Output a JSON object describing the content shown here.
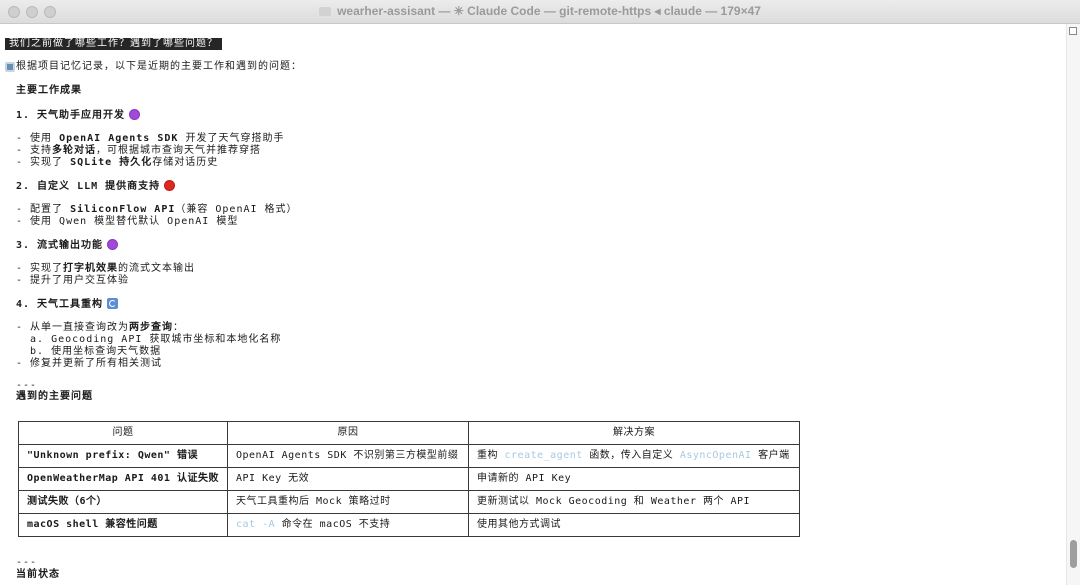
{
  "window": {
    "title": "wearher-assisant — ✳ Claude Code — git-remote-https ◂ claude — 179×47"
  },
  "prompt": {
    "text": " 我们之前做了哪些工作？遇到了哪些问题？"
  },
  "answer": {
    "intro": "根据项目记忆记录，以下是近期的主要工作和遇到的问题：",
    "section_achievements": "主要工作成果",
    "items": [
      {
        "heading": "1. 天气助手应用开发",
        "bullets": [
          [
            "- 使用 ",
            "OpenAI Agents SDK",
            " 开发了天气穿搭助手"
          ],
          [
            "- 支持",
            "多轮对话",
            "，可根据城市查询天气并推荐穿搭"
          ],
          [
            "- 实现了 ",
            "SQLite 持久化",
            "存储对话历史"
          ]
        ]
      },
      {
        "heading": "2. 自定义 LLM 提供商支持",
        "bullets": [
          [
            "- 配置了 ",
            "SiliconFlow API",
            "（兼容 OpenAI 格式）"
          ],
          [
            "- 使用 Qwen 模型替代默认 OpenAI 模型",
            "",
            ""
          ]
        ]
      },
      {
        "heading": "3. 流式输出功能",
        "bullets": [
          [
            "- 实现了",
            "打字机效果",
            "的流式文本输出"
          ],
          [
            "- 提升了用户交互体验",
            "",
            ""
          ]
        ]
      },
      {
        "heading": "4. 天气工具重构",
        "bullets": [
          [
            "- 从单一直接查询改为",
            "两步查询",
            "："
          ],
          [
            "  a. Geocoding API 获取城市坐标和本地化名称",
            "",
            ""
          ],
          [
            "  b. 使用坐标查询天气数据",
            "",
            ""
          ],
          [
            "- 修复并更新了所有相关测试",
            "",
            ""
          ]
        ]
      }
    ],
    "separator": "---",
    "section_problems": "遇到的主要问题",
    "table": {
      "headers": [
        "问题",
        "原因",
        "解决方案"
      ],
      "rows": [
        {
          "problem": "\"Unknown prefix: Qwen\" 错误",
          "cause": "OpenAI Agents SDK 不识别第三方模型前缀",
          "solution_pre": "重构 ",
          "solution_code1": "create_agent",
          "solution_mid": " 函数，传入自定义 ",
          "solution_code2": "AsyncOpenAI",
          "solution_post": " 客户端"
        },
        {
          "problem": "OpenWeatherMap API 401 认证失败",
          "cause": "API Key 无效",
          "solution": "申请新的 API Key"
        },
        {
          "problem": "测试失败（6个）",
          "cause": "天气工具重构后 Mock 策略过时",
          "solution": "更新测试以 Mock Geocoding 和 Weather 两个 API"
        },
        {
          "problem": "macOS shell 兼容性问题",
          "cause_code": "cat -A",
          "cause_post": " 命令在 macOS 不支持",
          "solution": "使用其他方式调试"
        }
      ]
    },
    "separator2": "---",
    "section_status": "当前状态"
  },
  "colors": {
    "prompt_bg": "#262626",
    "code_highlight": "#a8c8e0",
    "emoji_purple": "#a24ad6",
    "emoji_red": "#e0281f"
  }
}
